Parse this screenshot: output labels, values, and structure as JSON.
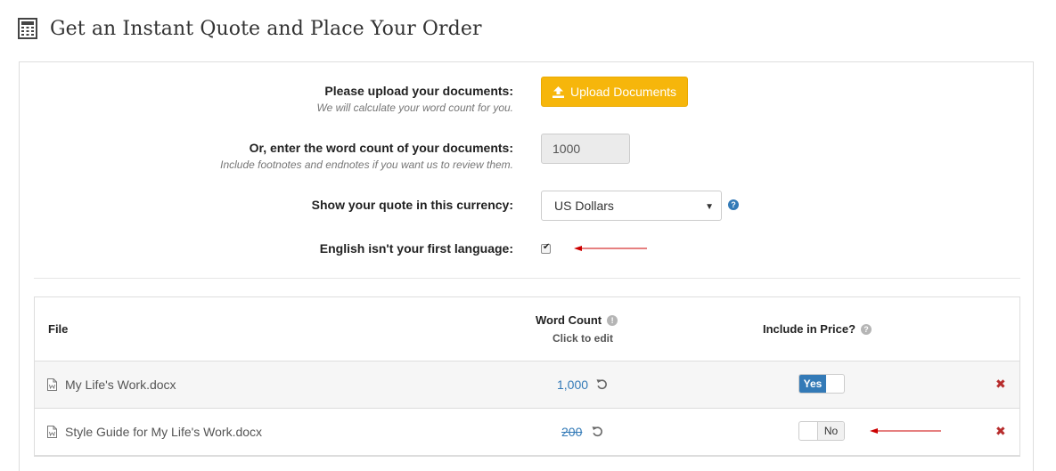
{
  "header": {
    "title": "Get an Instant Quote and Place Your Order",
    "icon": "calculator-icon"
  },
  "form": {
    "upload": {
      "label": "Please upload your documents:",
      "hint": "We will calculate your word count for you.",
      "button_label": "Upload Documents",
      "button_icon": "upload-icon"
    },
    "word_count": {
      "label": "Or, enter the word count of your documents:",
      "hint": "Include footnotes and endnotes if you want us to review them.",
      "value": "1000"
    },
    "currency": {
      "label": "Show your quote in this currency:",
      "selected": "US Dollars",
      "help_icon": "question-icon"
    },
    "language": {
      "label": "English isn't your first language:",
      "checked": true
    }
  },
  "table": {
    "headers": {
      "file": "File",
      "word_count": "Word Count",
      "word_count_sub": "Click to edit",
      "include": "Include in Price?"
    },
    "rows": [
      {
        "file": "My Life's Work.docx",
        "count": "1,000",
        "include_label": "Yes",
        "included": true
      },
      {
        "file": "Style Guide for My Life's Work.docx",
        "count": "200",
        "include_label": "No",
        "included": false
      }
    ]
  },
  "colors": {
    "accent": "#f6b60b",
    "link": "#337ab7",
    "danger": "#b72c2c",
    "annotation": "#cc0000"
  }
}
